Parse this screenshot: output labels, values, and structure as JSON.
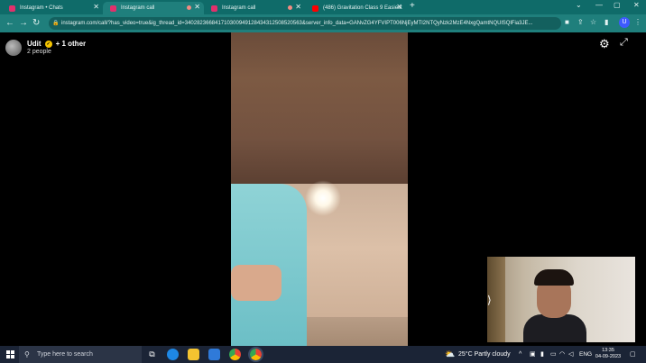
{
  "browser": {
    "tabs": [
      {
        "title": "Instagram • Chats",
        "icon": "instagram-icon"
      },
      {
        "title": "Instagram call",
        "icon": "instagram-icon"
      },
      {
        "title": "Instagram call",
        "icon": "instagram-icon"
      },
      {
        "title": "(486) Gravitation Class 9 Easiest",
        "icon": "youtube-icon"
      }
    ],
    "url": "instagram.com/call/?has_video=true&ig_thread_id=340282366841710300949128434312508520563&server_info_data=GANvZG4YFVIPT006NjEyMTI2NTQyNzk2MzE4NxgQamtNQUlSQlFia3JE...",
    "profile_initial": "U",
    "accent": "#1f7f7c"
  },
  "call": {
    "caller_name": "Udit",
    "caller_suffix": "+ 1 other",
    "participants": "2 people",
    "badge": "✓"
  },
  "taskbar": {
    "search_placeholder": "Type here to search",
    "weather": "25°C  Partly cloudy",
    "language": "ENG",
    "time": "13:35",
    "date": "04-09-2023"
  }
}
